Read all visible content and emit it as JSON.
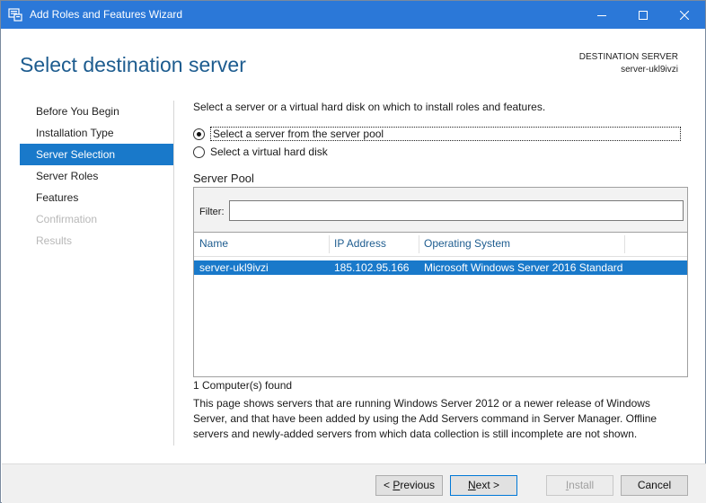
{
  "window": {
    "title": "Add Roles and Features Wizard",
    "accent": "#2b78d8"
  },
  "header": {
    "page_title": "Select destination server",
    "dest_label": "DESTINATION SERVER",
    "dest_value": "server-ukl9ivzi"
  },
  "nav": {
    "items": [
      {
        "label": "Before You Begin",
        "state": "normal"
      },
      {
        "label": "Installation Type",
        "state": "normal"
      },
      {
        "label": "Server Selection",
        "state": "active"
      },
      {
        "label": "Server Roles",
        "state": "normal"
      },
      {
        "label": "Features",
        "state": "normal"
      },
      {
        "label": "Confirmation",
        "state": "disabled"
      },
      {
        "label": "Results",
        "state": "disabled"
      }
    ]
  },
  "main": {
    "instruction": "Select a server or a virtual hard disk on which to install roles and features.",
    "radio_pool": "Select a server from the server pool",
    "radio_vhd": "Select a virtual hard disk",
    "pool_title": "Server Pool",
    "filter_label": "Filter:",
    "filter_value": "",
    "columns": [
      "Name",
      "IP Address",
      "Operating System"
    ],
    "rows": [
      [
        "server-ukl9ivzi",
        "185.102.95.166",
        "Microsoft Windows Server 2016 Standard"
      ]
    ],
    "found": "1 Computer(s) found",
    "description": "This page shows servers that are running Windows Server 2012 or a newer release of Windows Server, and that have been added by using the Add Servers command in Server Manager. Offline servers and newly-added servers from which data collection is still incomplete are not shown."
  },
  "footer": {
    "previous_pre": "< ",
    "previous_u": "P",
    "previous_post": "revious",
    "next_u": "N",
    "next_post": "ext >",
    "install_u": "I",
    "install_post": "nstall",
    "cancel": "Cancel"
  }
}
